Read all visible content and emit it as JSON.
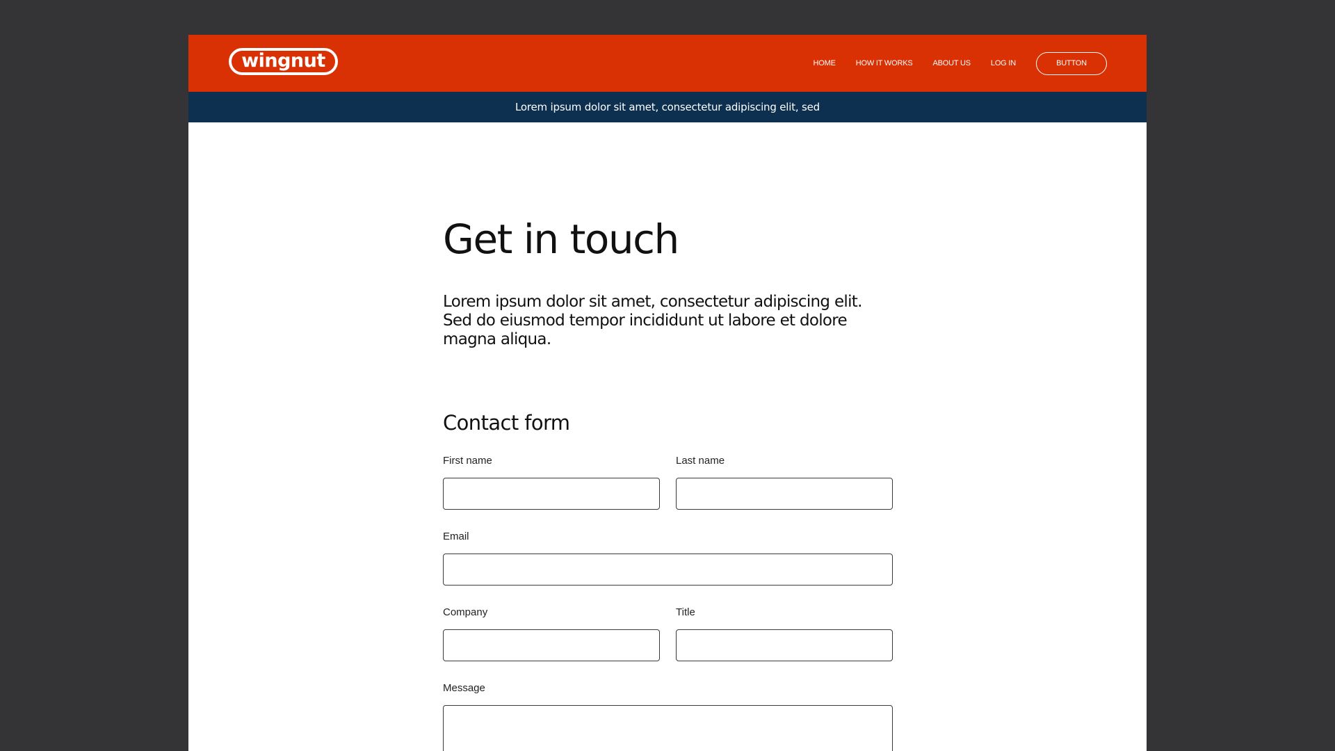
{
  "header": {
    "logo_text": "wingnut",
    "nav_links": [
      "HOME",
      "HOW IT WORKS",
      "ABOUT US",
      "LOG IN"
    ],
    "button_label": "BUTTON",
    "colors": {
      "brand": "#d93004",
      "banner": "#0d3050",
      "backdrop": "#343436"
    }
  },
  "banner": {
    "text": "Lorem ipsum dolor sit amet, consectetur adipiscing elit, sed"
  },
  "main": {
    "title": "Get in touch",
    "intro": "Lorem ipsum dolor sit amet, consectetur adipiscing elit. Sed do eiusmod tempor incididunt ut labore et dolore magna aliqua.",
    "form": {
      "title": "Contact form",
      "first_name_label": "First name",
      "first_name_value": "",
      "last_name_label": "Last name",
      "last_name_value": "",
      "email_label": "Email",
      "email_value": "",
      "company_label": "Company",
      "company_value": "",
      "title_label": "Title",
      "title_value": "",
      "message_label": "Message",
      "message_value": ""
    }
  }
}
